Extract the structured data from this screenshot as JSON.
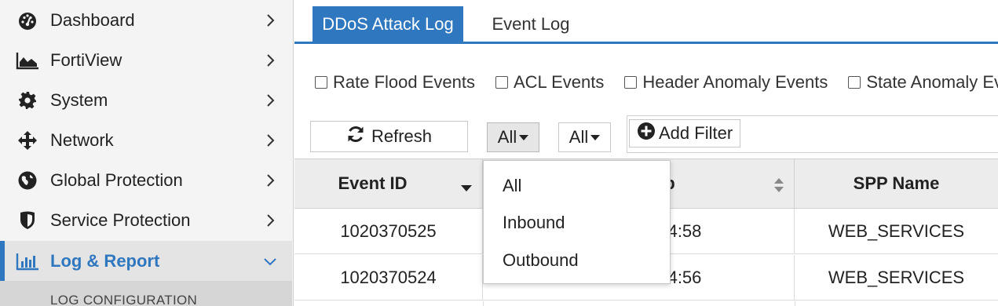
{
  "sidebar": {
    "items": [
      {
        "label": "Dashboard",
        "icon": "dashboard-icon"
      },
      {
        "label": "FortiView",
        "icon": "area-chart-icon"
      },
      {
        "label": "System",
        "icon": "gear-icon"
      },
      {
        "label": "Network",
        "icon": "move-arrows-icon"
      },
      {
        "label": "Global Protection",
        "icon": "globe-icon"
      },
      {
        "label": "Service Protection",
        "icon": "shield-icon"
      },
      {
        "label": "Log & Report",
        "icon": "bar-chart-icon",
        "active": true
      }
    ],
    "subheader": "LOG CONFIGURATION"
  },
  "tabs": [
    {
      "label": "DDoS Attack Log",
      "active": true
    },
    {
      "label": "Event Log",
      "active": false
    }
  ],
  "filters": {
    "checkboxes": [
      {
        "label": "Rate Flood Events",
        "checked": false
      },
      {
        "label": "ACL Events",
        "checked": false
      },
      {
        "label": "Header Anomaly Events",
        "checked": false
      },
      {
        "label": "State Anomaly Ev",
        "checked": false
      }
    ]
  },
  "toolbar": {
    "refresh_label": "Refresh",
    "direction_select": "All",
    "second_select": "All",
    "add_filter_label": "Add Filter"
  },
  "table": {
    "columns": [
      "Event ID",
      "p",
      "SPP Name"
    ],
    "rows": [
      {
        "event_id": "1020370525",
        "timestamp": "7:04:58",
        "spp_name": "WEB_SERVICES"
      },
      {
        "event_id": "1020370524",
        "timestamp": "7:04:56",
        "spp_name": "WEB_SERVICES"
      }
    ]
  },
  "dropdown": {
    "options": [
      "All",
      "Inbound",
      "Outbound"
    ]
  },
  "colors": {
    "accent": "#2f77bf",
    "sidebar_bg": "#f4f4f4",
    "header_bg": "#ececec"
  }
}
